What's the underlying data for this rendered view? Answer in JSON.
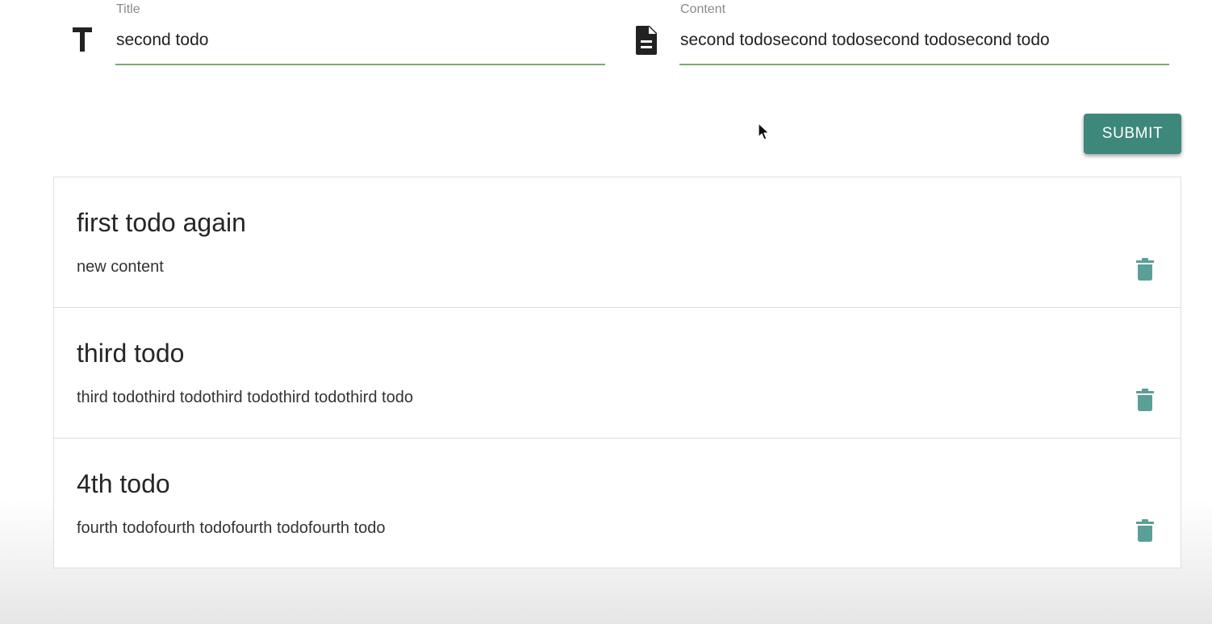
{
  "form": {
    "title": {
      "label": "Title",
      "value": "second todo",
      "icon": "title-icon"
    },
    "content": {
      "label": "Content",
      "value": "second todosecond todosecond todosecond todo",
      "icon": "description-icon"
    },
    "submit_label": "SUBMIT"
  },
  "todos": [
    {
      "title": "first todo again",
      "content": "new content"
    },
    {
      "title": "third todo",
      "content": "third todothird todothird todothird todothird todo"
    },
    {
      "title": "4th todo",
      "content": "fourth todofourth todofourth todofourth todo"
    }
  ],
  "colors": {
    "accent": "#3e877b",
    "delete_icon": "#5a9f98",
    "field_underline": "#7aab6d",
    "text": "#222222",
    "label": "#8a8a8a"
  },
  "icons": {
    "delete": "trash-icon",
    "cursor": "cursor-arrow-icon"
  }
}
